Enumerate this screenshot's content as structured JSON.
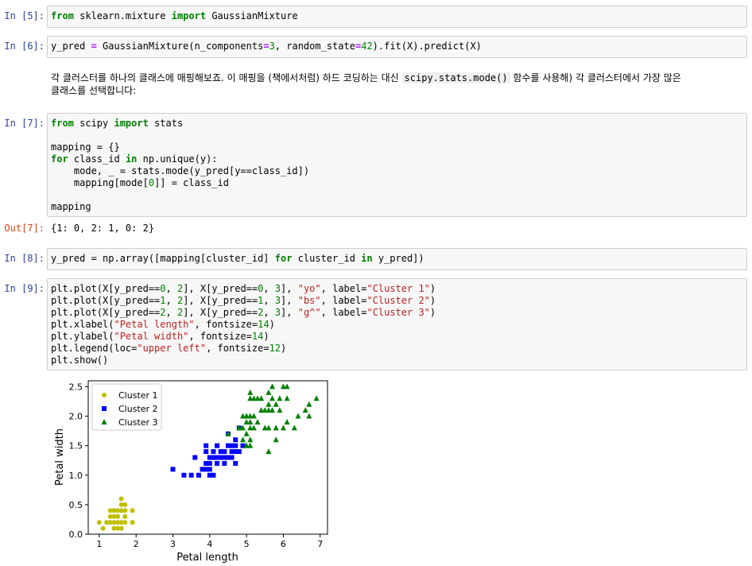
{
  "cells": {
    "c5": {
      "prompt": "In [5]:",
      "kw1": "from",
      "mod": " sklearn.mixture ",
      "kw2": "import",
      "name": " GaussianMixture"
    },
    "c6": {
      "prompt": "In [6]:",
      "a": "y_pred ",
      "eq": "=",
      "b": " GaussianMixture(n_components",
      "eq2": "=",
      "n3": "3",
      "c": ", random_state",
      "eq3": "=",
      "n42": "42",
      "d": ").fit(X).predict(X)"
    },
    "md1": {
      "text1": "각 클러스터를 하나의 클래스에 매핑해보죠. 이 매핑을 (책에서처럼) 하드 코딩하는 대신 ",
      "code": "scipy.stats.mode()",
      "text2": " 함수를 사용해) 각 클러스터에서 가장 많은",
      "text3": "클래스를 선택합니다:"
    },
    "c7": {
      "prompt": "In [7]:",
      "l1_kw1": "from",
      "l1_mid": " scipy ",
      "l1_kw2": "import",
      "l1_end": " stats",
      "l3": "mapping = {}",
      "l4_kw1": "for",
      "l4_a": " class_id ",
      "l4_kw2": "in",
      "l4_b": " np.unique(y):",
      "l5": "    mode, _ = stats.mode(y_pred[y==class_id])",
      "l6_a": "    mapping[mode[",
      "l6_n": "0",
      "l6_b": "]] = class_id",
      "l8": "mapping"
    },
    "out7": {
      "prompt": "Out[7]:",
      "text": "{1: 0, 2: 1, 0: 2}"
    },
    "c8": {
      "prompt": "In [8]:",
      "a": "y_pred = np.array([mapping[cluster_id] ",
      "kw1": "for",
      "b": " cluster_id ",
      "kw2": "in",
      "c": " y_pred])"
    },
    "c9": {
      "prompt": "In [9]:",
      "l1_a": "plt.plot(X[y_pred==",
      "l1_n0": "0",
      "l1_b": ", ",
      "l1_n1": "2",
      "l1_c": "], X[y_pred==",
      "l1_n2": "0",
      "l1_d": ", ",
      "l1_n3": "3",
      "l1_e": "], ",
      "l1_s1": "\"yo\"",
      "l1_f": ", label=",
      "l1_s2": "\"Cluster 1\"",
      "l1_g": ")",
      "l2_a": "plt.plot(X[y_pred==",
      "l2_n0": "1",
      "l2_b": ", ",
      "l2_n1": "2",
      "l2_c": "], X[y_pred==",
      "l2_n2": "1",
      "l2_d": ", ",
      "l2_n3": "3",
      "l2_e": "], ",
      "l2_s1": "\"bs\"",
      "l2_f": ", label=",
      "l2_s2": "\"Cluster 2\"",
      "l2_g": ")",
      "l3_a": "plt.plot(X[y_pred==",
      "l3_n0": "2",
      "l3_b": ", ",
      "l3_n1": "2",
      "l3_c": "], X[y_pred==",
      "l3_n2": "2",
      "l3_d": ", ",
      "l3_n3": "3",
      "l3_e": "], ",
      "l3_s1": "\"g^\"",
      "l3_f": ", label=",
      "l3_s2": "\"Cluster 3\"",
      "l3_g": ")",
      "l4_a": "plt.xlabel(",
      "l4_s": "\"Petal length\"",
      "l4_b": ", fontsize=",
      "l4_n": "14",
      "l4_c": ")",
      "l5_a": "plt.ylabel(",
      "l5_s": "\"Petal width\"",
      "l5_b": ", fontsize=",
      "l5_n": "14",
      "l5_c": ")",
      "l6_a": "plt.legend(loc=",
      "l6_s": "\"upper left\"",
      "l6_b": ", fontsize=",
      "l6_n": "12",
      "l6_c": ")",
      "l7": "plt.show()"
    }
  },
  "colors": {
    "cluster1": "#bfbf00",
    "cluster2": "#0000ff",
    "cluster3": "#008000"
  },
  "chart_data": {
    "type": "scatter",
    "xlabel": "Petal length",
    "ylabel": "Petal width",
    "xlim": [
      0.7,
      7.2
    ],
    "ylim": [
      0.0,
      2.6
    ],
    "xticks": [
      1,
      2,
      3,
      4,
      5,
      6,
      7
    ],
    "yticks": [
      0.0,
      0.5,
      1.0,
      1.5,
      2.0,
      2.5
    ],
    "xtick_labels": [
      "1",
      "2",
      "3",
      "4",
      "5",
      "6",
      "7"
    ],
    "ytick_labels": [
      "0.0",
      "0.5",
      "1.0",
      "1.5",
      "2.0",
      "2.5"
    ],
    "legend_position": "upper left",
    "grid": false,
    "series": [
      {
        "name": "Cluster 1",
        "marker": "circle",
        "color": "#bfbf00",
        "points": [
          [
            1.0,
            0.2
          ],
          [
            1.1,
            0.1
          ],
          [
            1.2,
            0.2
          ],
          [
            1.3,
            0.2
          ],
          [
            1.3,
            0.3
          ],
          [
            1.3,
            0.4
          ],
          [
            1.4,
            0.1
          ],
          [
            1.4,
            0.2
          ],
          [
            1.4,
            0.3
          ],
          [
            1.4,
            0.4
          ],
          [
            1.5,
            0.1
          ],
          [
            1.5,
            0.2
          ],
          [
            1.5,
            0.3
          ],
          [
            1.5,
            0.4
          ],
          [
            1.6,
            0.2
          ],
          [
            1.6,
            0.4
          ],
          [
            1.6,
            0.6
          ],
          [
            1.6,
            0.5
          ],
          [
            1.7,
            0.2
          ],
          [
            1.7,
            0.3
          ],
          [
            1.7,
            0.4
          ],
          [
            1.7,
            0.5
          ],
          [
            1.9,
            0.2
          ],
          [
            1.9,
            0.4
          ],
          [
            1.5,
            0.2
          ],
          [
            1.6,
            0.1
          ]
        ]
      },
      {
        "name": "Cluster 2",
        "marker": "square",
        "color": "#0000ff",
        "points": [
          [
            3.0,
            1.1
          ],
          [
            3.3,
            1.0
          ],
          [
            3.5,
            1.0
          ],
          [
            3.6,
            1.3
          ],
          [
            3.7,
            1.0
          ],
          [
            3.8,
            1.1
          ],
          [
            3.9,
            1.1
          ],
          [
            3.9,
            1.2
          ],
          [
            3.9,
            1.4
          ],
          [
            4.0,
            1.0
          ],
          [
            4.0,
            1.2
          ],
          [
            4.0,
            1.3
          ],
          [
            4.1,
            1.0
          ],
          [
            4.1,
            1.3
          ],
          [
            4.2,
            1.2
          ],
          [
            4.2,
            1.3
          ],
          [
            4.2,
            1.5
          ],
          [
            4.3,
            1.3
          ],
          [
            4.4,
            1.2
          ],
          [
            4.4,
            1.3
          ],
          [
            4.4,
            1.4
          ],
          [
            4.5,
            1.3
          ],
          [
            4.5,
            1.5
          ],
          [
            4.5,
            1.7
          ],
          [
            4.6,
            1.3
          ],
          [
            4.6,
            1.4
          ],
          [
            4.6,
            1.5
          ],
          [
            4.7,
            1.2
          ],
          [
            4.7,
            1.4
          ],
          [
            4.7,
            1.5
          ],
          [
            4.7,
            1.6
          ],
          [
            4.8,
            1.4
          ],
          [
            4.8,
            1.8
          ],
          [
            4.9,
            1.5
          ],
          [
            4.1,
            1.4
          ],
          [
            3.9,
            1.5
          ],
          [
            4.3,
            1.4
          ],
          [
            4.0,
            1.1
          ]
        ]
      },
      {
        "name": "Cluster 3",
        "marker": "triangle",
        "color": "#008000",
        "points": [
          [
            4.5,
            1.7
          ],
          [
            4.8,
            1.8
          ],
          [
            4.9,
            1.8
          ],
          [
            4.9,
            2.0
          ],
          [
            5.0,
            1.5
          ],
          [
            5.0,
            1.7
          ],
          [
            5.0,
            1.9
          ],
          [
            5.0,
            2.0
          ],
          [
            5.1,
            1.5
          ],
          [
            5.1,
            1.6
          ],
          [
            5.1,
            1.8
          ],
          [
            5.1,
            1.9
          ],
          [
            5.1,
            2.0
          ],
          [
            5.1,
            2.3
          ],
          [
            5.1,
            2.4
          ],
          [
            5.2,
            2.0
          ],
          [
            5.2,
            2.3
          ],
          [
            5.3,
            1.9
          ],
          [
            5.3,
            2.3
          ],
          [
            5.4,
            2.1
          ],
          [
            5.4,
            2.3
          ],
          [
            5.5,
            1.8
          ],
          [
            5.5,
            2.1
          ],
          [
            5.6,
            1.4
          ],
          [
            5.6,
            1.8
          ],
          [
            5.6,
            2.1
          ],
          [
            5.6,
            2.2
          ],
          [
            5.6,
            2.4
          ],
          [
            5.7,
            2.1
          ],
          [
            5.7,
            2.3
          ],
          [
            5.7,
            2.5
          ],
          [
            5.8,
            1.6
          ],
          [
            5.8,
            1.8
          ],
          [
            5.8,
            2.2
          ],
          [
            5.9,
            2.1
          ],
          [
            5.9,
            2.3
          ],
          [
            6.0,
            1.8
          ],
          [
            6.0,
            2.5
          ],
          [
            6.1,
            1.9
          ],
          [
            6.1,
            2.3
          ],
          [
            6.1,
            2.5
          ],
          [
            6.3,
            1.8
          ],
          [
            6.4,
            2.0
          ],
          [
            6.6,
            2.1
          ],
          [
            6.7,
            2.0
          ],
          [
            6.7,
            2.2
          ],
          [
            6.9,
            2.3
          ],
          [
            5.0,
            2.0
          ],
          [
            4.9,
            1.6
          ],
          [
            4.8,
            1.8
          ],
          [
            5.2,
            1.8
          ],
          [
            5.0,
            1.5
          ]
        ]
      }
    ]
  }
}
